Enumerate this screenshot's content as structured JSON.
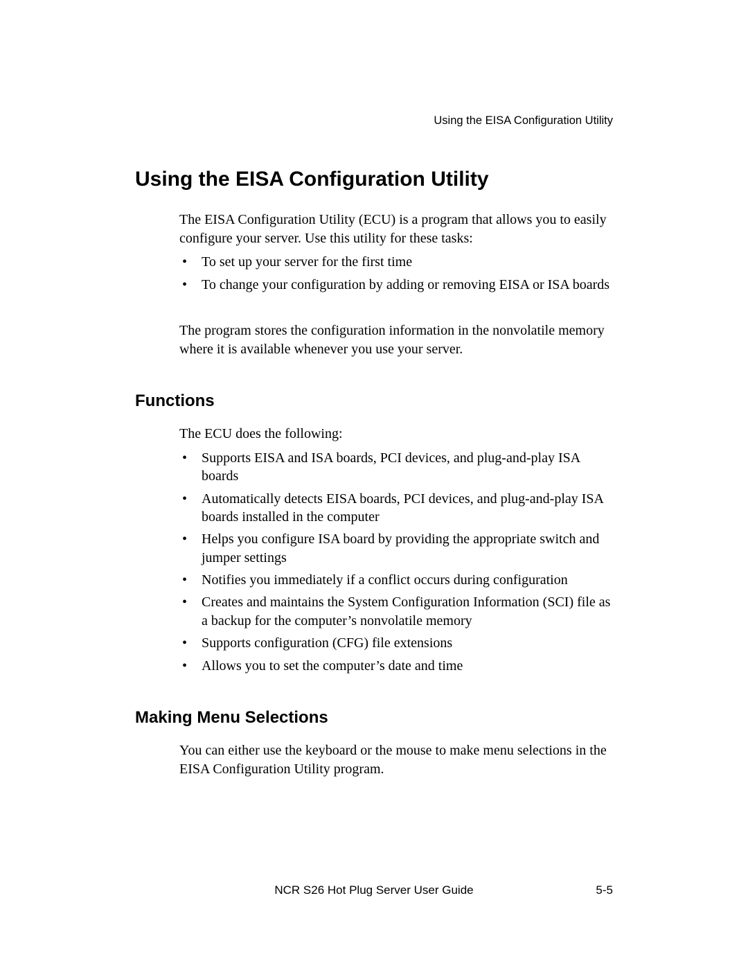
{
  "header": {
    "running_title": "Using the EISA Configuration Utility"
  },
  "main": {
    "heading": "Using the EISA Configuration Utility",
    "intro_para": "The EISA Configuration Utility (ECU) is a program that allows you to easily configure your server. Use this utility for these tasks:",
    "intro_bullets": [
      "To set up your server for the first time",
      "To change your configuration by adding or removing EISA or ISA boards"
    ],
    "storage_para": "The program stores the configuration information in the nonvolatile memory where it is available whenever you use your server."
  },
  "functions": {
    "heading": "Functions",
    "intro": "The ECU does the following:",
    "bullets": [
      "Supports EISA and ISA boards, PCI devices, and plug-and-play ISA boards",
      "Automatically detects EISA boards, PCI devices, and plug-and-play ISA boards installed in the computer",
      "Helps you configure ISA board by providing the appropriate switch and jumper settings",
      "Notifies you immediately if a conflict occurs during configuration",
      "Creates and maintains the System Configuration Information (SCI) file as a backup for the computer’s nonvolatile memory",
      "Supports configuration (CFG) file extensions",
      "Allows you to set the computer’s date and time"
    ]
  },
  "menu_selections": {
    "heading": "Making Menu Selections",
    "para": "You can either use the keyboard or the mouse to make menu selections in the EISA Configuration Utility program."
  },
  "footer": {
    "title": "NCR S26 Hot Plug Server User Guide",
    "page": "5-5"
  }
}
